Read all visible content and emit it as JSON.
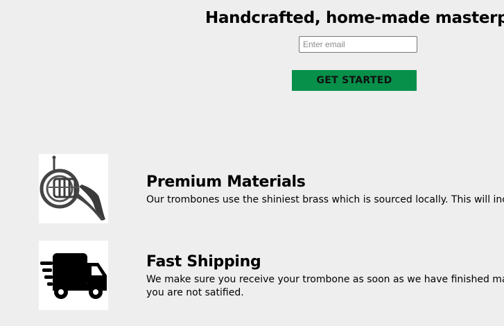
{
  "hero": {
    "title": "Handcrafted, home-made masterpieces",
    "email_placeholder": "Enter email",
    "cta_label": "GET STARTED",
    "cta_color": "#06904a"
  },
  "features": [
    {
      "icon": "french-horn-icon",
      "title": "Premium Materials",
      "text": "Our trombones use the shiniest brass which is sourced locally. This will incr"
    },
    {
      "icon": "delivery-truck-icon",
      "title": "Fast Shipping",
      "text": "We make sure you receive your trombone as soon as we have finished maki you are not satified."
    }
  ]
}
